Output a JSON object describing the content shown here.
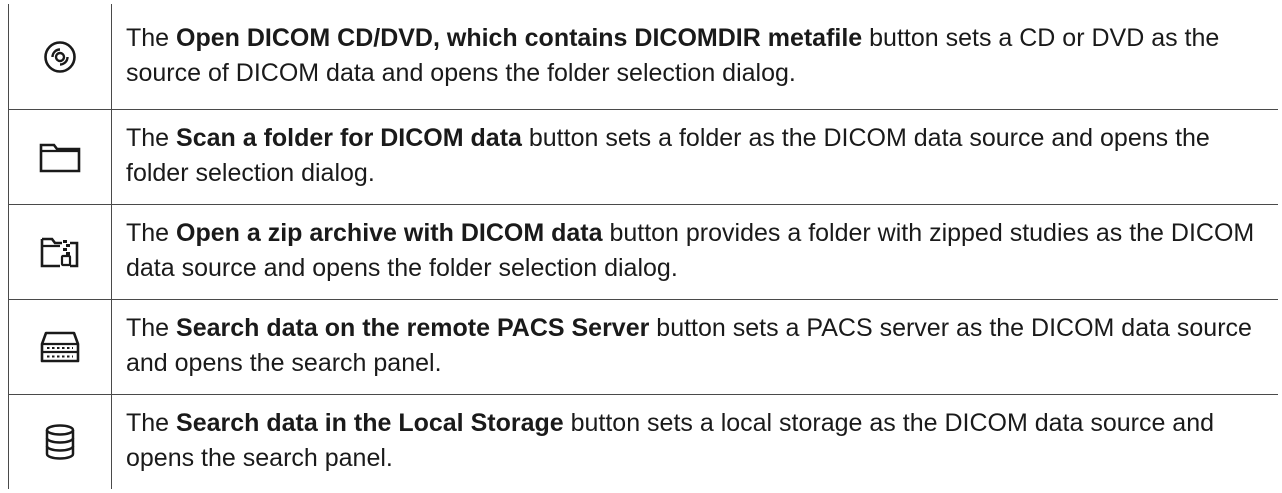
{
  "rows": [
    {
      "icon": "cd-dvd-icon",
      "prefix": "The ",
      "bold": "Open DICOM CD/DVD, which contains DICOMDIR metafile",
      "suffix": " button sets a CD or DVD as the source of DICOM data and opens the folder selection dialog."
    },
    {
      "icon": "folder-icon",
      "prefix": "The ",
      "bold": "Scan a folder for DICOM data",
      "suffix": " button sets a folder as the DICOM data source and opens the folder selection dialog."
    },
    {
      "icon": "zip-archive-icon",
      "prefix": "The ",
      "bold": "Open a zip archive with DICOM data",
      "suffix": " button provides a folder with zipped studies as the DICOM data source and opens the folder selection dialog."
    },
    {
      "icon": "pacs-server-icon",
      "prefix": "The ",
      "bold": "Search data on the remote PACS Server",
      "suffix": " button sets a PACS server as the DICOM data source and opens the search panel."
    },
    {
      "icon": "database-icon",
      "prefix": "The ",
      "bold": "Search data in the Local Storage",
      "suffix": " button sets a local storage as the DICOM data source and opens the search panel."
    }
  ]
}
